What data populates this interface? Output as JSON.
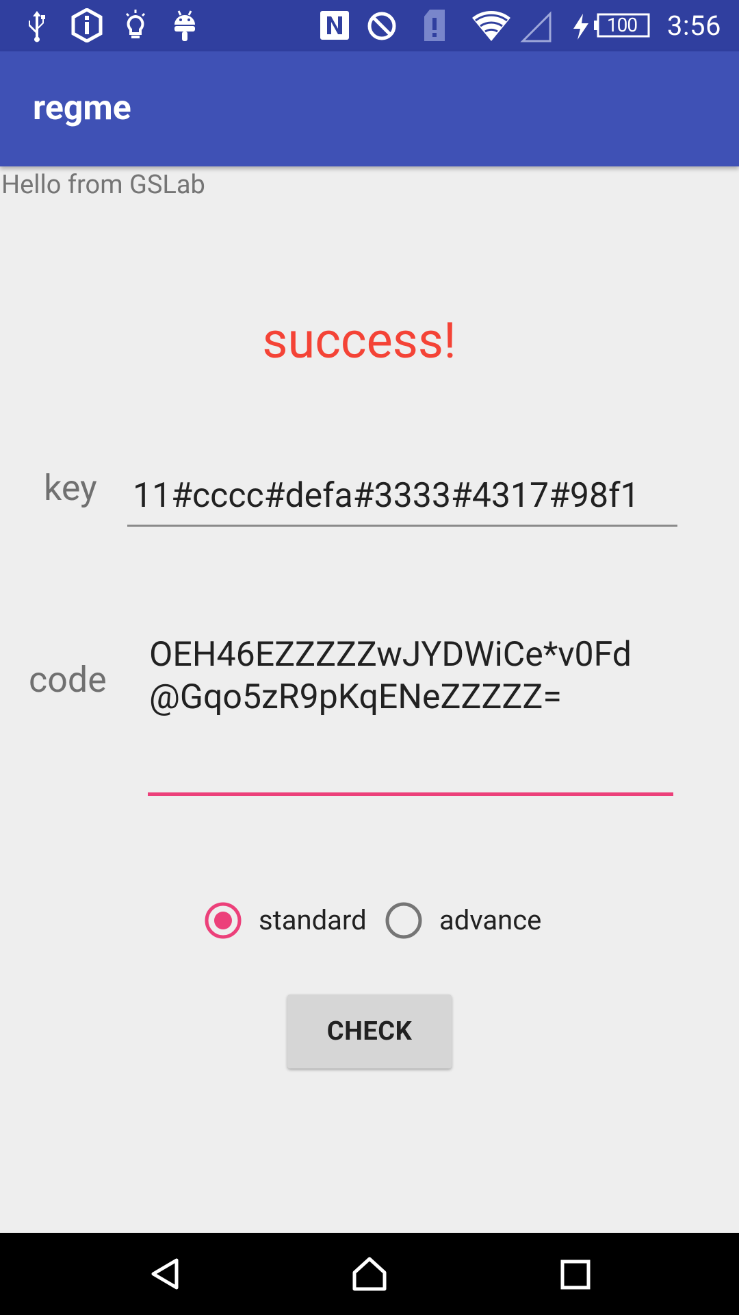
{
  "status_bar": {
    "time": "3:56",
    "battery_level": "100",
    "icons": [
      "usb-icon",
      "debug-icon",
      "bulb-icon",
      "android-icon",
      "nfc-icon",
      "do-not-disturb-icon",
      "sim-alert-icon",
      "wifi-icon",
      "signal-icon",
      "charging-icon",
      "battery-icon"
    ]
  },
  "app_bar": {
    "title": "regme"
  },
  "main": {
    "greeting": "Hello from GSLab",
    "result_text": "success!",
    "key_label": "key",
    "key_value": "11#cccc#defa#3333#4317#98f1",
    "code_label": "code",
    "code_value": "OEH46EZZZZZwJYDWiCe*v0Fd\n@Gqo5zR9pKqENeZZZZZ=",
    "mode_options": [
      {
        "label": "standard",
        "selected": true
      },
      {
        "label": "advance",
        "selected": false
      }
    ],
    "check_button": "CHECK"
  },
  "nav_bar": {
    "icons": [
      "back-icon",
      "home-icon",
      "recents-icon"
    ]
  },
  "colors": {
    "status_bar": "#303f9f",
    "app_bar": "#3f51b5",
    "accent": "#ec407a",
    "success": "#f44336",
    "background": "#eeeeee"
  }
}
